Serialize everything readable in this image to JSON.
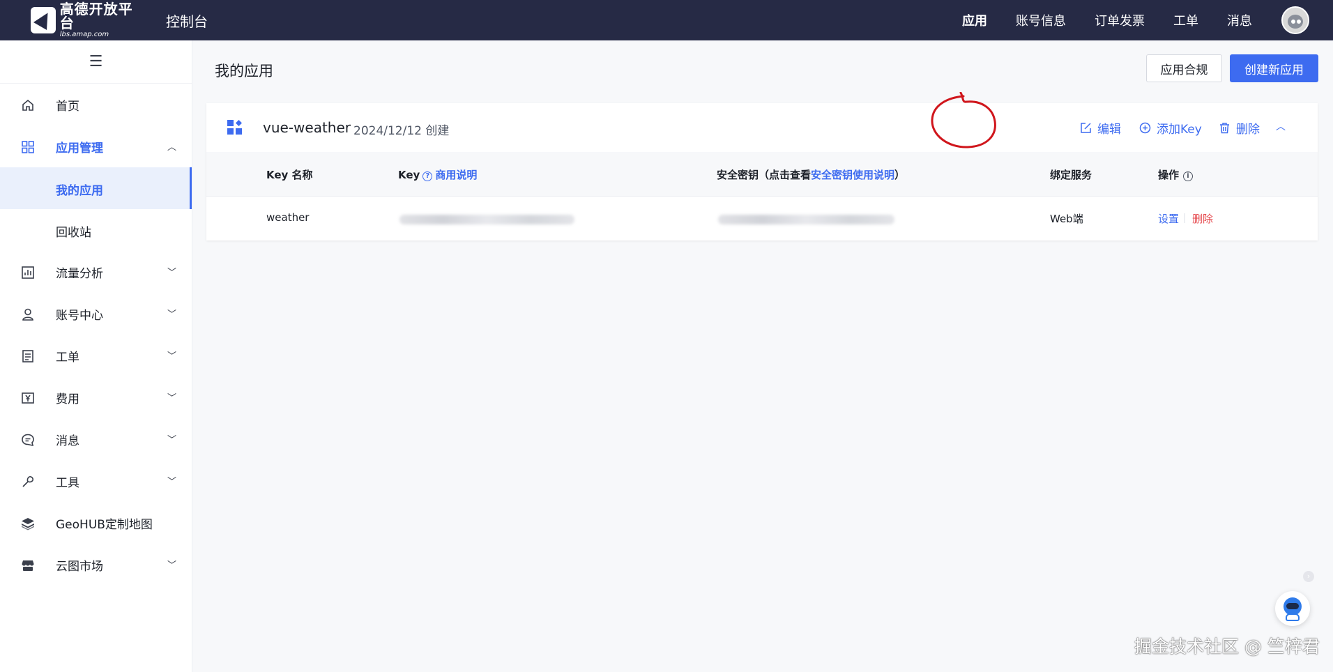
{
  "topbar": {
    "logo_name": "高德开放平台",
    "logo_url": "lbs.amap.com",
    "console_title": "控制台",
    "nav": [
      "应用",
      "账号信息",
      "订单发票",
      "工单",
      "消息"
    ]
  },
  "sidebar": {
    "menu_icon": "☰",
    "items": {
      "home": "首页",
      "app_mgmt": "应用管理",
      "my_apps": "我的应用",
      "recycle": "回收站",
      "traffic": "流量分析",
      "account": "账号中心",
      "tickets": "工单",
      "fees": "费用",
      "messages": "消息",
      "tools": "工具",
      "geohub": "GeoHUB定制地图",
      "cloud_market": "云图市场"
    }
  },
  "main": {
    "title": "我的应用",
    "compliance_button": "应用合规",
    "create_button": "创建新应用"
  },
  "app": {
    "name": "vue-weather",
    "created": "2024/12/12 创建",
    "actions": {
      "edit": "编辑",
      "add_key": "添加Key",
      "delete": "删除"
    },
    "table": {
      "headers": {
        "key_name": "Key 名称",
        "key": "Key",
        "key_link": "商用说明",
        "secret_prefix": "安全密钥（点击查看",
        "secret_link": "安全密钥使用说明",
        "secret_suffix": "）",
        "service": "绑定服务",
        "ops": "操作"
      },
      "rows": [
        {
          "key_name": "weather",
          "service": "Web端",
          "settings": "设置",
          "delete": "删除"
        }
      ]
    }
  },
  "watermark": "掘金技术社区 @ 竺梓君",
  "colors": {
    "topbar": "#262a45",
    "accent": "#3d6bf0",
    "danger": "#e5484d"
  }
}
